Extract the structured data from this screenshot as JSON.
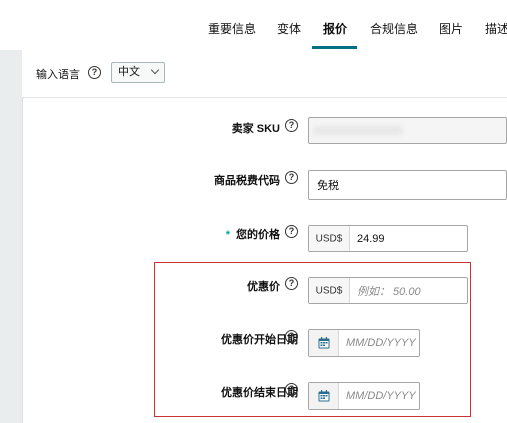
{
  "tabs": {
    "items": [
      {
        "label": "重要信息",
        "active": false
      },
      {
        "label": "变体",
        "active": false
      },
      {
        "label": "报价",
        "active": true
      },
      {
        "label": "合规信息",
        "active": false
      },
      {
        "label": "图片",
        "active": false
      },
      {
        "label": "描述",
        "active": false
      }
    ]
  },
  "language": {
    "label": "输入语言",
    "selected": "中文"
  },
  "form": {
    "sku": {
      "label": "卖家 SKU",
      "value": ""
    },
    "tax_code": {
      "label": "商品税费代码",
      "value": "免税"
    },
    "your_price": {
      "required_mark": "*",
      "label": "您的价格",
      "currency": "USD$",
      "value": "24.99"
    },
    "sale_price": {
      "label": "优惠价",
      "currency": "USD$",
      "placeholder": "例如： 50.00"
    },
    "sale_start": {
      "label": "优惠价开始日期",
      "placeholder": "MM/DD/YYYY"
    },
    "sale_end": {
      "label": "优惠价结束日期",
      "placeholder": "MM/DD/YYYY"
    }
  },
  "colors": {
    "accent": "#007185",
    "highlight_border": "#cc3333",
    "required": "#00a8a8"
  }
}
